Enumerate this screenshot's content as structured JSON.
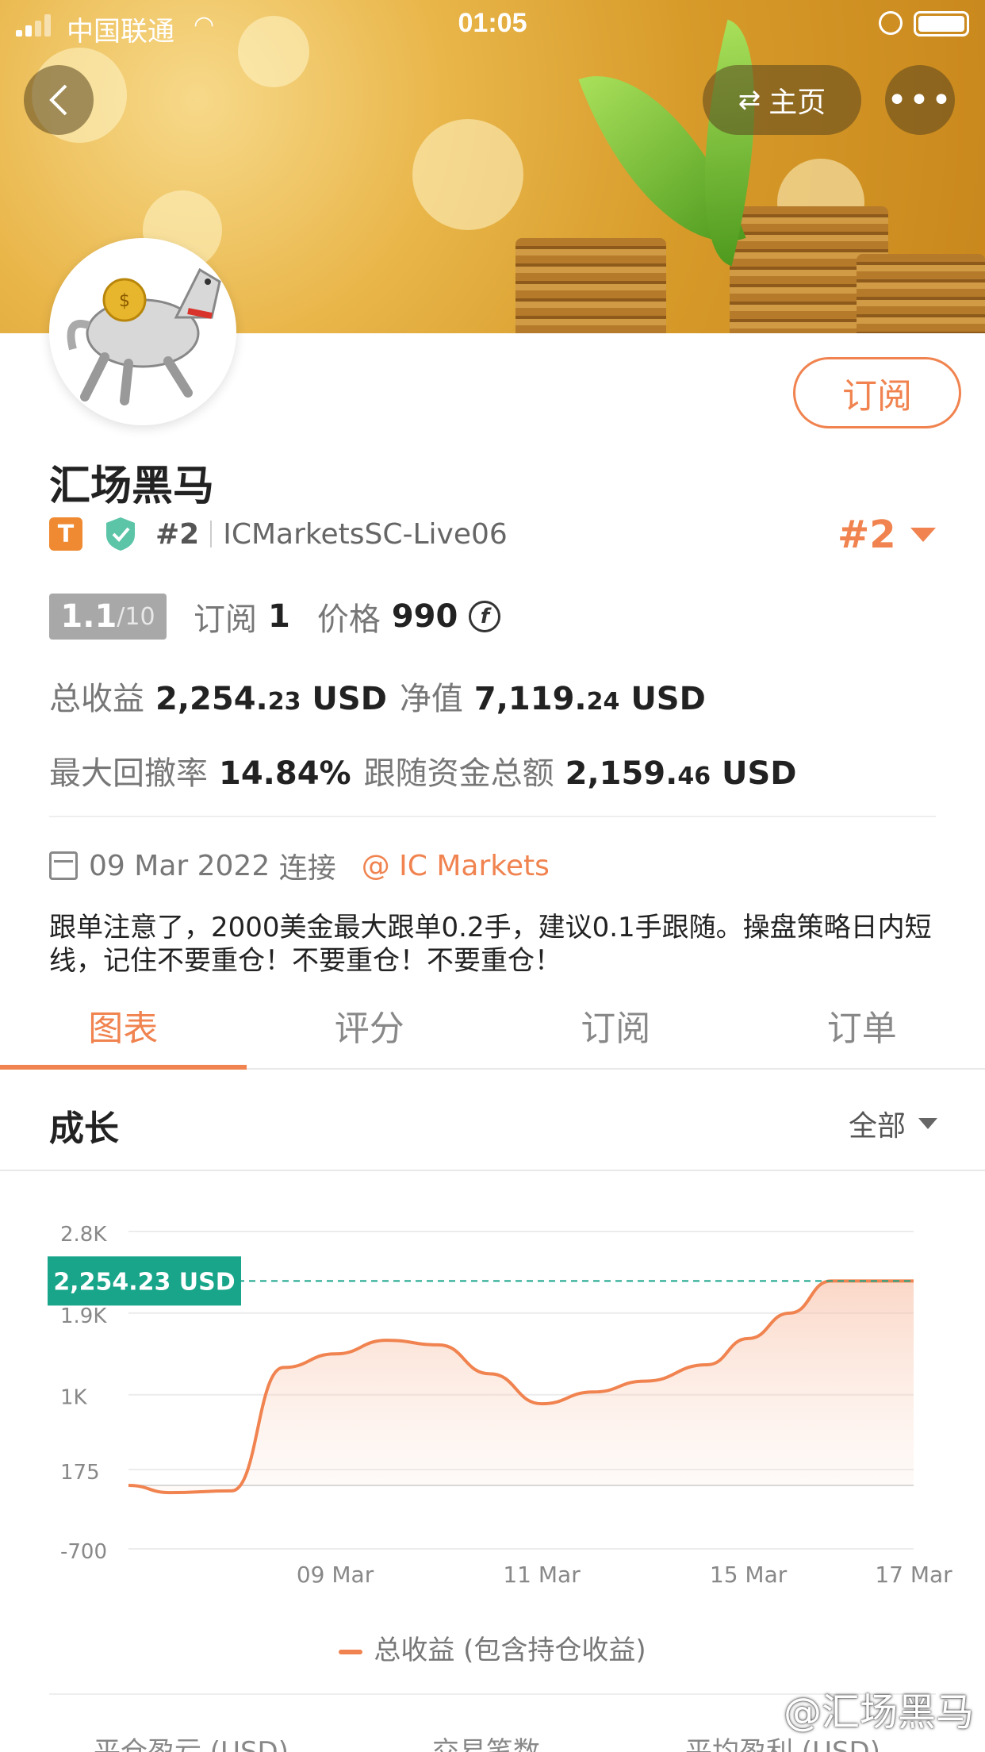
{
  "status_bar": {
    "carrier": "中国联通",
    "time": "01:05"
  },
  "header": {
    "home_label": "主页",
    "more_label": "•••"
  },
  "profile": {
    "name": "汇场黑马",
    "subscribe_label": "订阅",
    "tier_badge": "T",
    "rank_small": "#2",
    "server": "ICMarketsSC-Live06",
    "rank_big": "#2",
    "score_main": "1.1",
    "score_total": "/10",
    "subscriptions_label": "订阅",
    "subscriptions_value": "1",
    "price_label": "价格",
    "price_value": "990",
    "total_profit_label": "总收益",
    "total_profit_int": "2,254.",
    "total_profit_dec": "23",
    "total_profit_unit": "USD",
    "equity_label": "净值",
    "equity_int": "7,119.",
    "equity_dec": "24",
    "equity_unit": "USD",
    "max_drawdown_label": "最大回撤率",
    "max_drawdown_value": "14.84%",
    "follow_funds_label": "跟随资金总额",
    "follow_funds_int": "2,159.",
    "follow_funds_dec": "46",
    "follow_funds_unit": "USD",
    "connect_date": "09 Mar 2022",
    "connect_label": "连接",
    "broker": "@ IC Markets",
    "description": "跟单注意了，2000美金最大跟单0.2手，建议0.1手跟随。操盘策略日内短线，记住不要重仓！不要重仓！不要重仓！"
  },
  "tabs": [
    "图表",
    "评分",
    "订阅",
    "订单"
  ],
  "growth": {
    "title": "成长",
    "range_label": "全部"
  },
  "chart_data": {
    "type": "area",
    "y_tick_labels": [
      "2.8K",
      "1.9K",
      "1K",
      "175",
      "-700"
    ],
    "y_ticks": [
      2800,
      1900,
      1000,
      175,
      -700
    ],
    "ylim": [
      -700,
      2800
    ],
    "x_tick_labels": [
      "09 Mar",
      "11 Mar",
      "15 Mar",
      "17 Mar"
    ],
    "x_tick_positions": [
      1,
      3,
      5,
      6.6
    ],
    "xlim": [
      -1,
      6.6
    ],
    "series": [
      {
        "name": "总收益 (包含持仓收益)",
        "color": "#f0834f",
        "x": [
          -1,
          -0.6,
          0,
          0.5,
          1,
          1.5,
          2,
          2.5,
          3,
          3.5,
          4,
          4.6,
          5,
          5.4,
          5.8,
          6.2,
          6.6
        ],
        "values": [
          0,
          -80,
          -60,
          1300,
          1450,
          1600,
          1550,
          1230,
          900,
          1030,
          1150,
          1330,
          1620,
          1900,
          2254.23,
          2254.23,
          2254.23
        ]
      }
    ],
    "current_value_label": "2,254.23 USD",
    "current_value": 2254.23
  },
  "footer_labels": [
    "平仓盈亏 (USD)",
    "交易笔数",
    "平均盈利 (USD)"
  ],
  "watermark": "@汇场黑马"
}
